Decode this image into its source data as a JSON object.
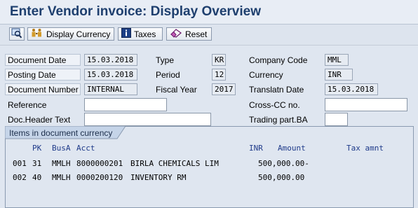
{
  "title": "Enter Vendor invoice: Display Overview",
  "toolbar": {
    "display_currency": "Display Currency",
    "taxes": "Taxes",
    "reset": "Reset"
  },
  "header": {
    "document_date_label": "Document Date",
    "document_date": "15.03.2018",
    "posting_date_label": "Posting Date",
    "posting_date": "15.03.2018",
    "document_number_label": "Document Number",
    "document_number": "INTERNAL",
    "reference_label": "Reference",
    "doc_header_text_label": "Doc.Header Text",
    "type_label": "Type",
    "type": "KR",
    "period_label": "Period",
    "period": "12",
    "fiscal_year_label": "Fiscal Year",
    "fiscal_year": "2017",
    "company_code_label": "Company Code",
    "company_code": "MML",
    "currency_label": "Currency",
    "currency": "INR",
    "translatn_date_label": "Translatn Date",
    "translatn_date": "15.03.2018",
    "cross_cc_label": "Cross-CC no.",
    "trading_part_label": "Trading part.BA"
  },
  "items": {
    "tab_label": "Items in document currency",
    "columns": {
      "pk": "PK",
      "busa": "BusA",
      "acct": "Acct",
      "inr": "INR",
      "amount": "Amount",
      "tax": "Tax amnt"
    },
    "rows": [
      {
        "num": "001",
        "pk": "31",
        "busa": "MMLH",
        "acct": "8000000201",
        "text": "BIRLA CHEMICALS LIM",
        "amount": "500,000.00-"
      },
      {
        "num": "002",
        "pk": "40",
        "busa": "MMLH",
        "acct": "0000200120",
        "text": "INVENTORY RM",
        "amount": "500,000.00"
      }
    ]
  }
}
